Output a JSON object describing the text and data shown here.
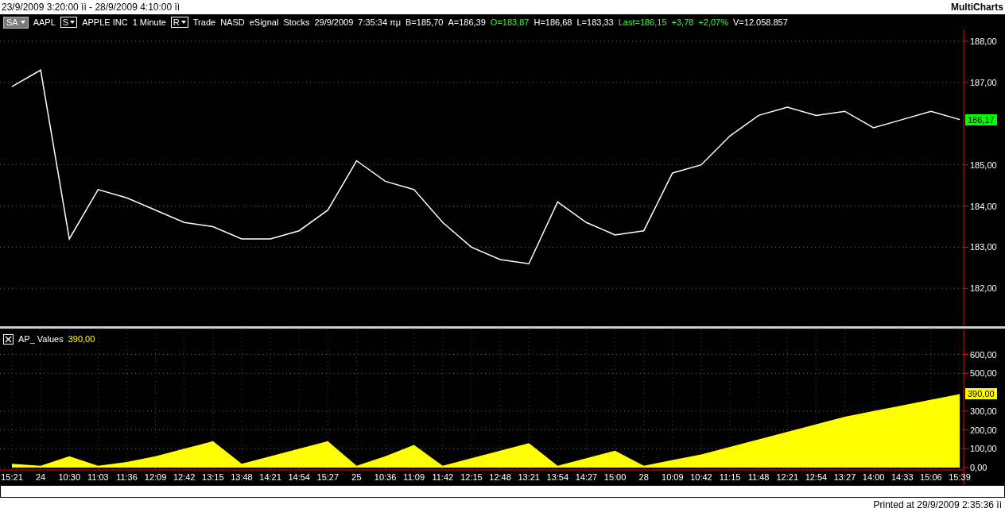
{
  "window": {
    "title": "23/9/2009 3:20:00 ìì - 28/9/2009 4:10:00 ìì",
    "app_name": "MultiCharts"
  },
  "header": [
    {
      "kind": "dropdown",
      "text": "SA"
    },
    {
      "kind": "text",
      "text": "AAPL"
    },
    {
      "kind": "boxed",
      "text": "S"
    },
    {
      "kind": "text",
      "text": "APPLE INC"
    },
    {
      "kind": "text",
      "text": "1 Minute"
    },
    {
      "kind": "boxed",
      "text": "R"
    },
    {
      "kind": "text",
      "text": "Trade"
    },
    {
      "kind": "text",
      "text": "NASD"
    },
    {
      "kind": "text",
      "text": "eSignal"
    },
    {
      "kind": "text",
      "text": "Stocks"
    },
    {
      "kind": "text",
      "text": "29/9/2009"
    },
    {
      "kind": "text",
      "text": "7:35:34 πμ"
    },
    {
      "kind": "text",
      "text": "B=185,70"
    },
    {
      "kind": "text",
      "text": "A=186,39"
    },
    {
      "kind": "text",
      "text": "O=183,87",
      "color": "#33ff33"
    },
    {
      "kind": "text",
      "text": "H=186,68"
    },
    {
      "kind": "text",
      "text": "L=183,33"
    },
    {
      "kind": "text",
      "text": "Last=186,15",
      "color": "#33ff33"
    },
    {
      "kind": "text",
      "text": "+3,78",
      "color": "#33ff33"
    },
    {
      "kind": "text",
      "text": "+2,07%",
      "color": "#33ff33"
    },
    {
      "kind": "text",
      "text": "V=12.058.857"
    }
  ],
  "price_pane": {
    "last_tag": "186,17",
    "chart_data": {
      "type": "line",
      "grid": true,
      "series": [
        {
          "color": "#ffffff",
          "values": [
            186.9,
            187.3,
            183.2,
            184.4,
            184.2,
            183.9,
            183.6,
            183.5,
            183.2,
            183.2,
            183.4,
            183.9,
            185.1,
            184.6,
            184.4,
            183.6,
            183.0,
            182.7,
            182.6,
            184.1,
            183.6,
            183.3,
            183.4,
            184.8,
            185.0,
            185.7,
            186.2,
            186.4,
            186.2,
            186.3,
            185.9,
            186.1,
            186.3,
            186.1
          ]
        }
      ],
      "ylim": [
        181.1,
        188.27
      ],
      "yticks": [
        {
          "value": 182,
          "label": "182,00"
        },
        {
          "value": 183,
          "label": "183,00"
        },
        {
          "value": 184,
          "label": "184,00"
        },
        {
          "value": 185,
          "label": "185,00"
        },
        {
          "value": 187,
          "label": "187,00"
        },
        {
          "value": 188,
          "label": "188,00"
        }
      ]
    }
  },
  "indicator_pane": {
    "name": "AP_ Values",
    "value": "390,00",
    "last_tag": "390,00",
    "chart_data": {
      "type": "area",
      "grid": true,
      "categories": [
        "15:21",
        "24",
        "10:30",
        "11:03",
        "11:36",
        "12:09",
        "12:42",
        "13:15",
        "13:48",
        "14:21",
        "14:54",
        "15:27",
        "25",
        "10:36",
        "11:09",
        "11:42",
        "12:15",
        "12:48",
        "13:21",
        "13:54",
        "14:27",
        "15:00",
        "28",
        "10:09",
        "10:42",
        "11:15",
        "11:48",
        "12:21",
        "12:54",
        "13:27",
        "14:00",
        "14:33",
        "15:06",
        "15:39"
      ],
      "series": [
        {
          "color": "#ffff00",
          "values": [
            20,
            10,
            60,
            10,
            30,
            60,
            100,
            140,
            20,
            60,
            100,
            140,
            10,
            60,
            120,
            10,
            50,
            90,
            130,
            10,
            50,
            90,
            10,
            40,
            70,
            110,
            150,
            190,
            230,
            270,
            300,
            330,
            360,
            390
          ]
        }
      ],
      "ylim": [
        -8,
        733
      ],
      "yticks": [
        {
          "value": 0,
          "label": "0,00"
        },
        {
          "value": 100,
          "label": "100,00"
        },
        {
          "value": 200,
          "label": "200,00"
        },
        {
          "value": 300,
          "label": "300,00"
        },
        {
          "value": 500,
          "label": "500,00"
        },
        {
          "value": 600,
          "label": "600,00"
        }
      ]
    }
  },
  "footer": "Printed at 29/9/2009 2:35:36 ìì"
}
